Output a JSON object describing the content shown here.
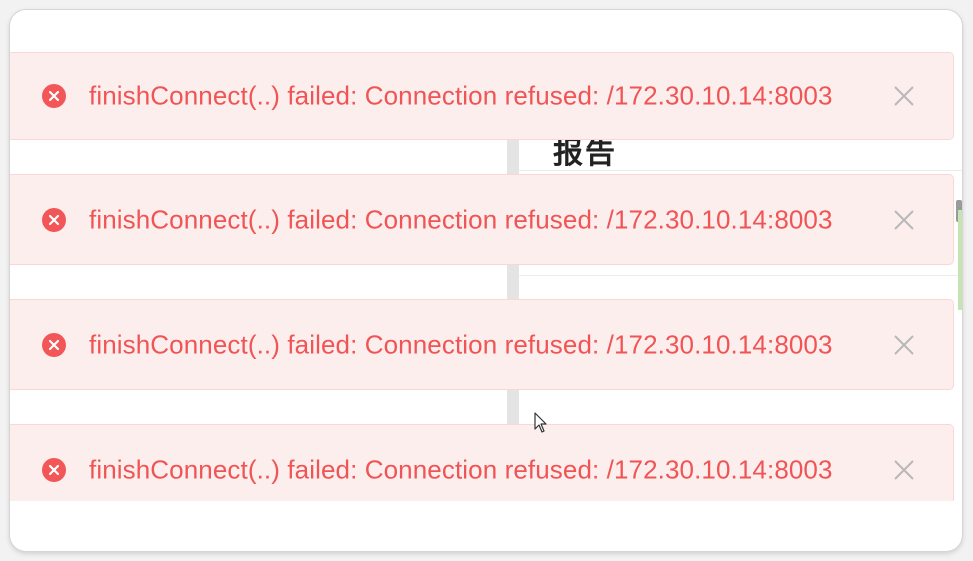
{
  "background": {
    "heading": "报告"
  },
  "toasts": [
    {
      "message": "finishConnect(..) failed: Connection refused: /172.30.10.14:8003",
      "icon": "error-circle-icon",
      "close_icon": "close-icon"
    },
    {
      "message": "finishConnect(..) failed: Connection refused: /172.30.10.14:8003",
      "icon": "error-circle-icon",
      "close_icon": "close-icon"
    },
    {
      "message": "finishConnect(..) failed: Connection refused: /172.30.10.14:8003",
      "icon": "error-circle-icon",
      "close_icon": "close-icon"
    },
    {
      "message": "finishConnect(..) failed: Connection refused: /172.30.10.14:8003",
      "icon": "error-circle-icon",
      "close_icon": "close-icon"
    }
  ],
  "colors": {
    "toast_background": "#fdeeee",
    "toast_border": "#fbd6d6",
    "error_text": "#f05454",
    "error_icon": "#f25656",
    "close_icon": "#b8b8b8"
  }
}
